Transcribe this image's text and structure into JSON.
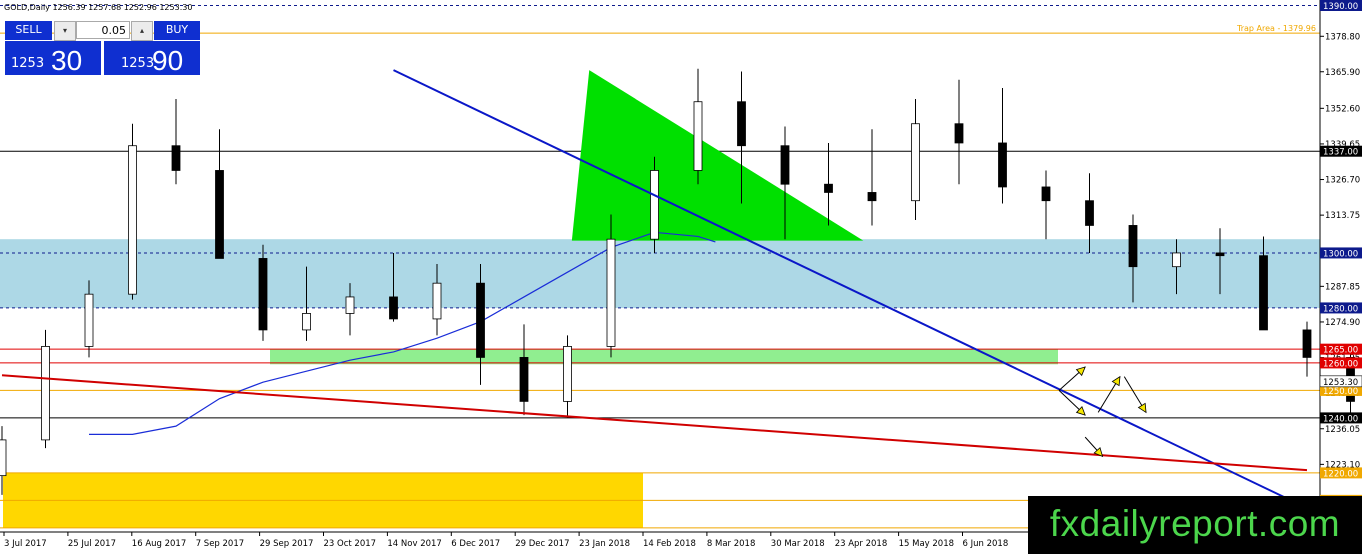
{
  "header": {
    "symbol_label": "GOLD,Daily",
    "ohlc": "1256.39 1257.68 1252.96 1253.30"
  },
  "trade_panel": {
    "sell_label": "SELL",
    "buy_label": "BUY",
    "lot": "0.05",
    "bid_small": "1253",
    "bid_big": "30",
    "ask_small": "1253",
    "ask_big": "90"
  },
  "brand": "fxdailyreport.com",
  "chart_data": {
    "type": "candlestick",
    "ylim": [
      1198.5,
      1392
    ],
    "y_ticks": [
      "1390.00",
      "1378.80",
      "1365.90",
      "1352.60",
      "1339.65",
      "1326.70",
      "1313.75",
      "1300.00",
      "1287.85",
      "1274.90",
      "1261.95",
      "1249.00",
      "1236.05",
      "1223.10"
    ],
    "x_ticks": [
      "3 Jul 2017",
      "25 Jul 2017",
      "16 Aug 2017",
      "7 Sep 2017",
      "29 Sep 2017",
      "23 Oct 2017",
      "14 Nov 2017",
      "6 Dec 2017",
      "29 Dec 2017",
      "23 Jan 2018",
      "14 Feb 2018",
      "8 Mar 2018",
      "30 Mar 2018",
      "23 Apr 2018",
      "15 May 2018",
      "6 Jun 2018"
    ],
    "price_levels": [
      {
        "value": 1390.0,
        "label": "1390.00",
        "color": "#0d1a8c",
        "style": "dashed"
      },
      {
        "value": 1379.96,
        "label": "Trap Area - 1379.96",
        "color": "#f0a800",
        "style": "solid"
      },
      {
        "value": 1337.0,
        "label": "1337.00",
        "color": "#000000",
        "style": "solid"
      },
      {
        "value": 1300.0,
        "label": "1300.00",
        "color": "#0d1a8c",
        "style": "dashed"
      },
      {
        "value": 1280.0,
        "label": "1280.00",
        "color": "#0d1a8c",
        "style": "dashed"
      },
      {
        "value": 1265.0,
        "label": "1265.00",
        "color": "#e00000",
        "style": "solid"
      },
      {
        "value": 1260.0,
        "label": "1260.00",
        "color": "#e00000",
        "style": "solid"
      },
      {
        "value": 1250.0,
        "label": "1250.00",
        "color": "#f0a800",
        "style": "solid"
      },
      {
        "value": 1240.0,
        "label": "1240.00",
        "color": "#000000",
        "style": "solid"
      },
      {
        "value": 1220.0,
        "label": "1220.00",
        "color": "#f0a800",
        "style": "solid"
      },
      {
        "value": 1210.0,
        "label": "1210.00",
        "color": "#f0a800",
        "style": "solid"
      },
      {
        "value": 1200.0,
        "label": "1200.00",
        "color": "#f0a800",
        "style": "solid"
      }
    ],
    "current_price": {
      "value": 1253.3,
      "label": "1253.30"
    },
    "zones": [
      {
        "from": 1280,
        "to": 1305,
        "color": "#add8e6"
      },
      {
        "from": 1259.5,
        "to": 1265,
        "color": "#90ee90"
      },
      {
        "from": 1200,
        "to": 1220,
        "color": "#ffd700"
      }
    ],
    "pattern": {
      "type": "descending-triangle",
      "color": "#00e000"
    },
    "trendlines": [
      {
        "color": "#0a17c8",
        "from": [
          9,
          1366.5
        ],
        "to": [
          29.5,
          1211
        ]
      },
      {
        "color": "#d00000",
        "from": [
          0,
          1255.5
        ],
        "to": [
          30,
          1221
        ]
      }
    ],
    "moving_average": {
      "color": "#1a2dd8",
      "points": [
        [
          2,
          1234
        ],
        [
          3,
          1234
        ],
        [
          4,
          1237
        ],
        [
          5,
          1247
        ],
        [
          6,
          1253
        ],
        [
          7,
          1257
        ],
        [
          8,
          1261
        ],
        [
          9,
          1264
        ],
        [
          10,
          1269
        ],
        [
          11,
          1275
        ],
        [
          12,
          1284
        ],
        [
          13,
          1293
        ],
        [
          14,
          1302
        ],
        [
          15,
          1307.5
        ],
        [
          16,
          1306
        ],
        [
          16.4,
          1304
        ]
      ]
    },
    "ohlc": [
      [
        1219,
        1237,
        1212,
        1232
      ],
      [
        1232,
        1272,
        1229,
        1266
      ],
      [
        1266,
        1290,
        1262,
        1285
      ],
      [
        1285,
        1347,
        1283,
        1339
      ],
      [
        1339,
        1356,
        1325,
        1330
      ],
      [
        1330,
        1345,
        1310,
        1298
      ],
      [
        1298,
        1303,
        1268,
        1272
      ],
      [
        1272,
        1295,
        1268,
        1278
      ],
      [
        1278,
        1289,
        1270,
        1284
      ],
      [
        1284,
        1300,
        1275,
        1276
      ],
      [
        1276,
        1296,
        1270,
        1289
      ],
      [
        1289,
        1296,
        1252,
        1262
      ],
      [
        1262,
        1274,
        1241,
        1246
      ],
      [
        1246,
        1270,
        1240,
        1266
      ],
      [
        1266,
        1314,
        1262,
        1305
      ],
      [
        1305,
        1335,
        1300,
        1330
      ],
      [
        1330,
        1367,
        1325,
        1355
      ],
      [
        1355,
        1366,
        1318,
        1339
      ],
      [
        1339,
        1346,
        1305,
        1325
      ],
      [
        1325,
        1340,
        1310,
        1322
      ],
      [
        1322,
        1345,
        1310,
        1319
      ],
      [
        1319,
        1356,
        1312,
        1347
      ],
      [
        1347,
        1363,
        1325,
        1340
      ],
      [
        1340,
        1360,
        1318,
        1324
      ],
      [
        1324,
        1330,
        1305,
        1319
      ],
      [
        1319,
        1329,
        1300,
        1310
      ],
      [
        1310,
        1314,
        1282,
        1295
      ],
      [
        1295,
        1305,
        1285,
        1300
      ],
      [
        1300,
        1309,
        1285,
        1299
      ],
      [
        1299,
        1306,
        1279,
        1272
      ],
      [
        1272,
        1275,
        1255,
        1262
      ],
      [
        1262,
        1264,
        1240,
        1246
      ],
      [
        1246,
        1261,
        1237,
        1253.3
      ]
    ],
    "projection_arrows": {
      "color": "#f5e600"
    }
  }
}
